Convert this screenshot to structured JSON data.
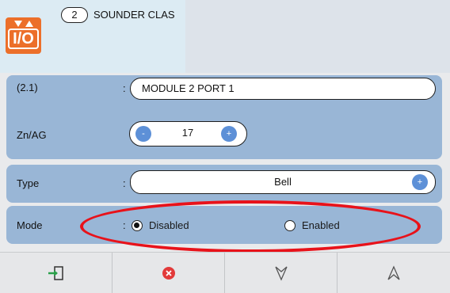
{
  "header": {
    "badge": "2",
    "title": "SOUNDER CLAS",
    "icon_text": "I/O"
  },
  "rows": {
    "address": {
      "label": "(2.1)",
      "colon": ":",
      "value": "MODULE 2 PORT 1"
    },
    "zone": {
      "label": "Zn/AG",
      "value": "17",
      "minus": "-",
      "plus": "+"
    },
    "type": {
      "label": "Type",
      "colon": ":",
      "value": "Bell",
      "plus": "+"
    },
    "mode": {
      "label": "Mode",
      "colon": ":",
      "options": [
        {
          "label": "Disabled",
          "selected": true
        },
        {
          "label": "Enabled",
          "selected": false
        }
      ]
    }
  },
  "toolbar": [
    "exit-icon",
    "cancel-icon",
    "down-icon",
    "up-icon"
  ],
  "colors": {
    "accent": "#ec6f2a",
    "panel": "#99b6d6",
    "button": "#5d90d7",
    "highlight": "#e8121a"
  }
}
